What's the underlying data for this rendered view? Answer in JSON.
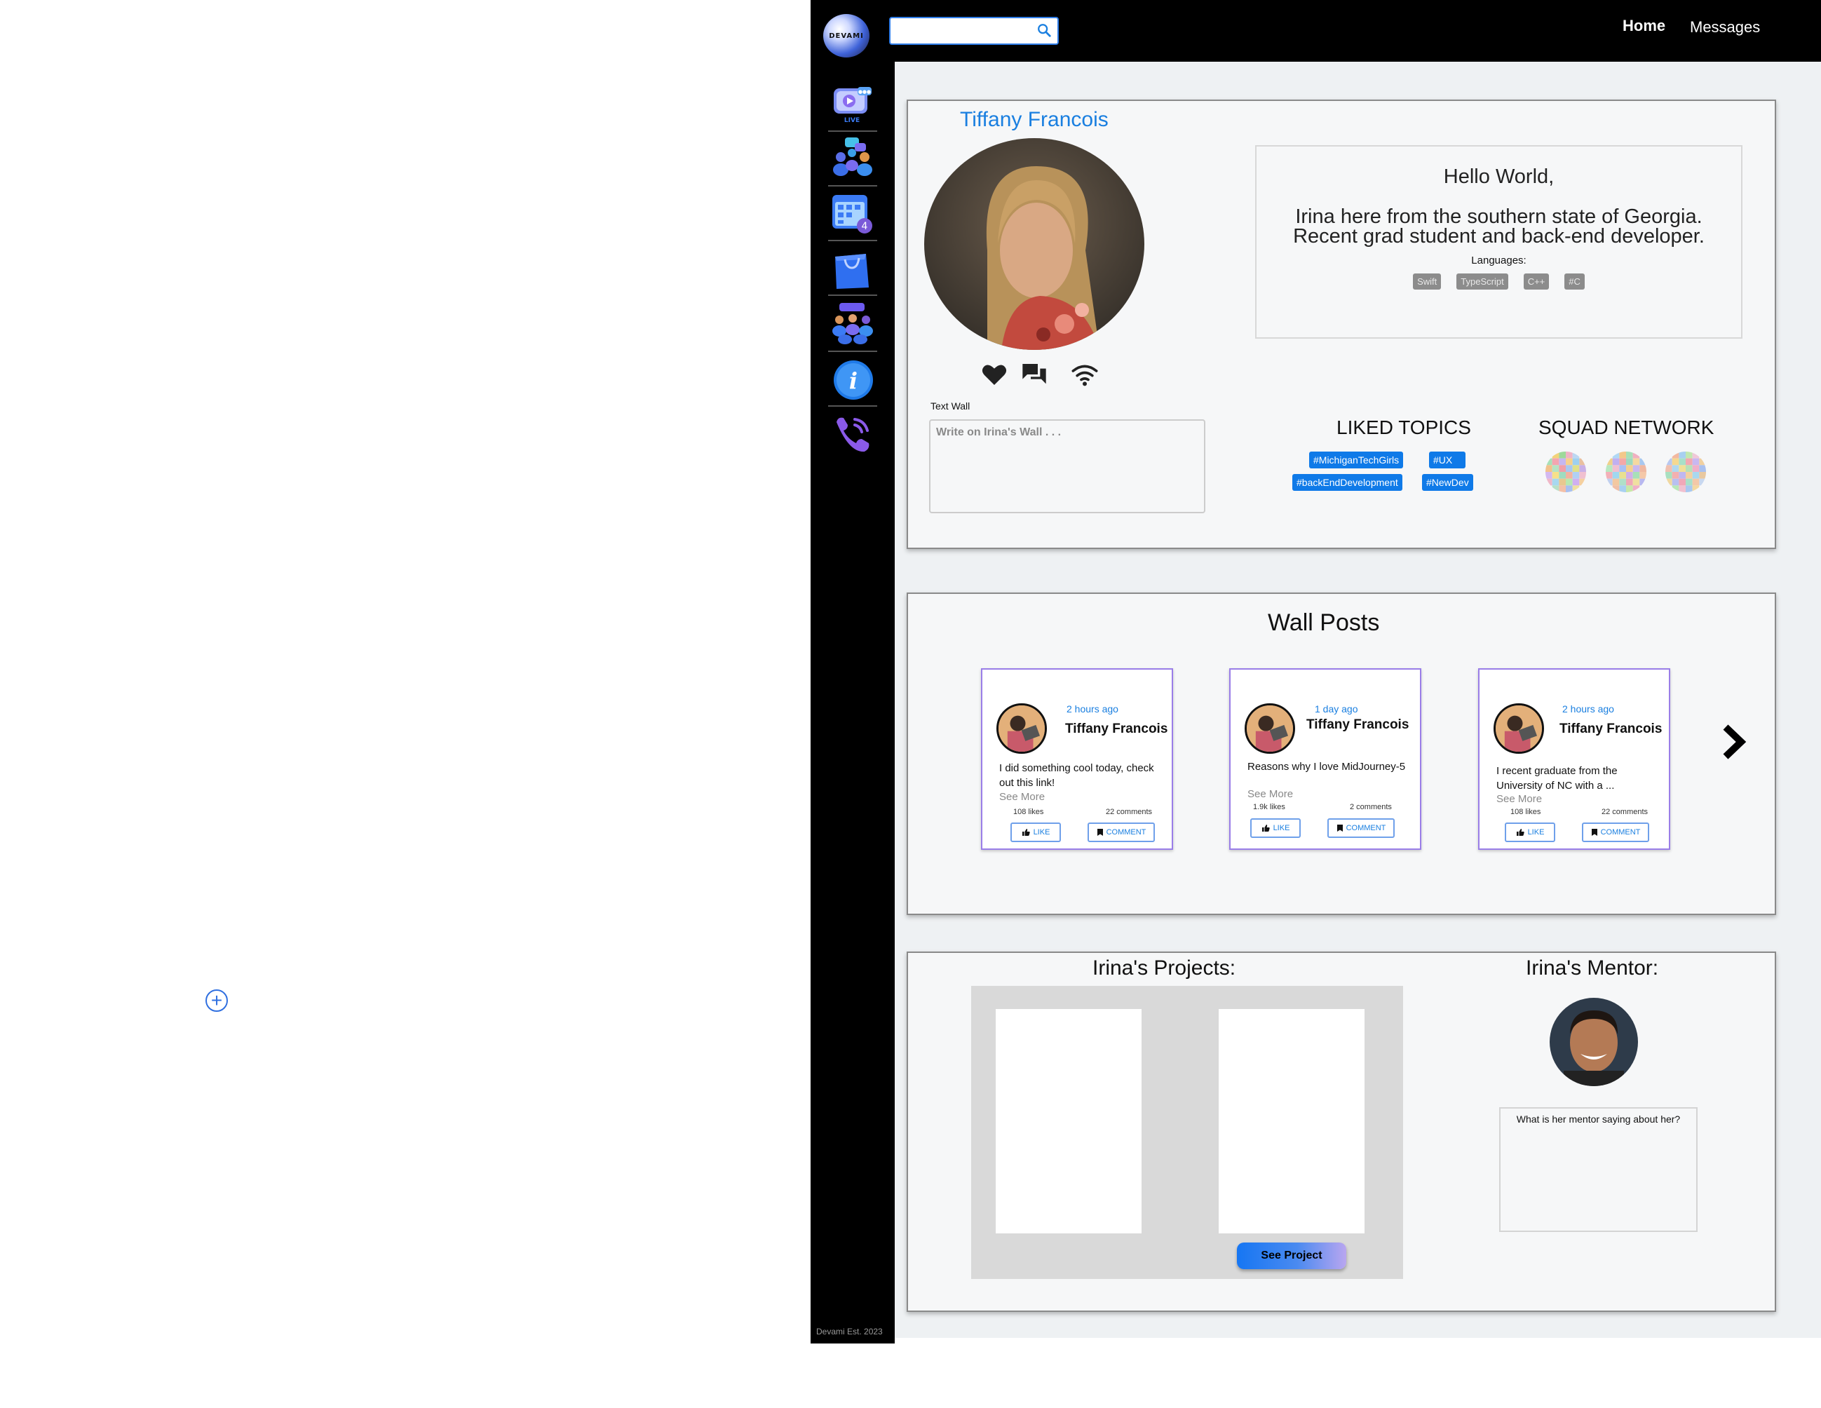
{
  "header": {
    "logo_text": "DEVAMI",
    "search": {
      "placeholder": ""
    },
    "nav": {
      "home": "Home",
      "messages": "Messages"
    }
  },
  "sidebar": {
    "items": [
      {
        "icon": "live-video-icon"
      },
      {
        "icon": "community-chat-icon"
      },
      {
        "icon": "calendar-icon",
        "badge": "4"
      },
      {
        "icon": "shopping-bag-icon"
      },
      {
        "icon": "group-icon"
      },
      {
        "icon": "info-icon"
      },
      {
        "icon": "phone-icon"
      }
    ],
    "footer": "Devami Est. 2023"
  },
  "profile": {
    "name": "Tiffany Francois",
    "text_wall_label": "Text Wall",
    "text_wall_placeholder": "Write on Irina's Wall . . .",
    "bio": {
      "greeting": "Hello World,",
      "text": "Irina here from the southern state of Georgia. Recent grad student and back-end developer.",
      "languages_label": "Languages:",
      "languages": [
        "Swift",
        "TypeScript",
        "C++",
        "#C"
      ]
    },
    "liked_topics": {
      "title": "LIKED TOPICS",
      "tags": [
        "#MichiganTechGirls",
        "#UX",
        "#backEndDevelopment",
        "#NewDev"
      ]
    },
    "squad_network": {
      "title": "SQUAD NETWORK"
    }
  },
  "wall_posts": {
    "title": "Wall Posts",
    "posts": [
      {
        "time": "2 hours ago",
        "author": "Tiffany Francois",
        "text": "I did something cool today, check out this link!",
        "see_more": "See More",
        "likes": "108 likes",
        "comments": "22 comments",
        "like_label": "LIKE",
        "comment_label": "COMMENT"
      },
      {
        "time": "1 day ago",
        "author": "Tiffany Francois",
        "text": "Reasons why I love MidJourney-5",
        "see_more": "See More",
        "likes": "1.9k likes",
        "comments": "2 comments",
        "like_label": "LIKE",
        "comment_label": "COMMENT"
      },
      {
        "time": "2 hours ago",
        "author": "Tiffany Francois",
        "text": "I recent graduate from the University of NC with a ...",
        "see_more": "See More",
        "likes": "108 likes",
        "comments": "22 comments",
        "like_label": "LIKE",
        "comment_label": "COMMENT"
      }
    ]
  },
  "projects": {
    "title": "Irina's Projects:",
    "see_project": "See Project"
  },
  "mentor": {
    "title": "Irina's Mentor:",
    "quote": "What is her mentor saying about her?"
  },
  "colors": {
    "accent": "#1a7fe0",
    "tag_blue": "#0f7ae8",
    "post_border": "#9a7ee8",
    "bar": "#000000"
  }
}
